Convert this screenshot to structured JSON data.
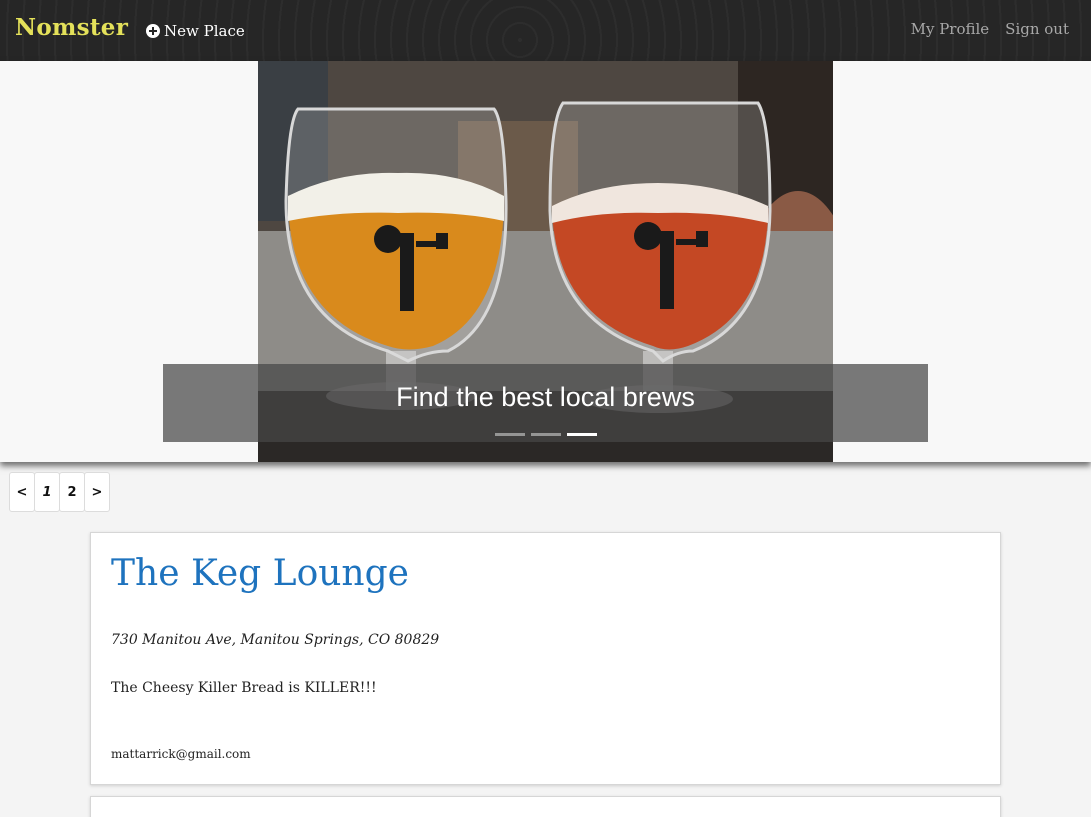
{
  "navbar": {
    "brand": "Nomster",
    "new_place_label": "New Place",
    "my_profile_label": "My Profile",
    "sign_out_label": "Sign out",
    "brand_color": "#e4e15a",
    "background_color": "#262626"
  },
  "carousel": {
    "caption": "Find the best local brews",
    "indicators": [
      {
        "active": false
      },
      {
        "active": false
      },
      {
        "active": true
      }
    ]
  },
  "pagination": {
    "prev_label": "<",
    "pages": [
      "1",
      "2"
    ],
    "current_page": "1",
    "next_label": ">"
  },
  "places": [
    {
      "name": "The Keg Lounge",
      "address": "730 Manitou Ave, Manitou Springs, CO 80829",
      "description": "The Cheesy Killer Bread is KILLER!!!",
      "email": "mattarrick@gmail.com"
    }
  ],
  "colors": {
    "link": "#1e73be",
    "page_background": "#f4f4f4"
  }
}
